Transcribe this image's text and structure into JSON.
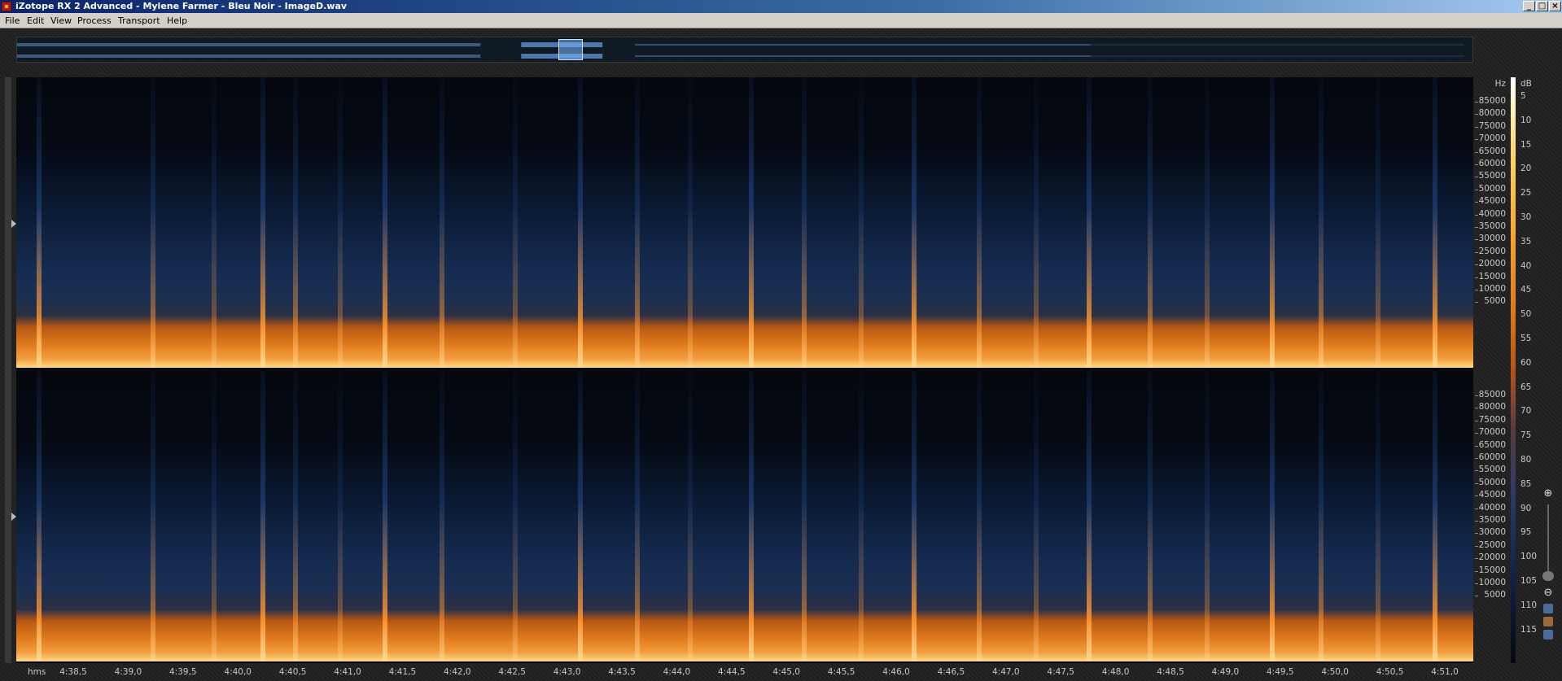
{
  "window": {
    "title": "iZotope RX 2 Advanced - Mylene Farmer - Bleu Noir - ImageD.wav",
    "controls": {
      "minimize": "_",
      "maximize": "□",
      "close": "×"
    }
  },
  "menu": [
    {
      "label": "File"
    },
    {
      "label": "Edit"
    },
    {
      "label": "View"
    },
    {
      "label": "Process"
    },
    {
      "label": "Transport"
    },
    {
      "label": "Help"
    }
  ],
  "spectrogram": {
    "hz_unit": "Hz",
    "hz_labels": [
      "85000",
      "80000",
      "75000",
      "70000",
      "65000",
      "60000",
      "55000",
      "50000",
      "45000",
      "40000",
      "35000",
      "30000",
      "25000",
      "20000",
      "15000",
      "10000",
      "5000"
    ],
    "db_unit": "dB",
    "db_labels": [
      "5",
      "10",
      "15",
      "20",
      "25",
      "30",
      "35",
      "40",
      "45",
      "50",
      "55",
      "60",
      "65",
      "70",
      "75",
      "80",
      "85",
      "90",
      "95",
      "100",
      "105",
      "110",
      "115"
    ],
    "time_unit": "hms",
    "time_labels": [
      "4:38,5",
      "4:39,0",
      "4:39,5",
      "4:40,0",
      "4:40,5",
      "4:41,0",
      "4:41,5",
      "4:42,0",
      "4:42,5",
      "4:43,0",
      "4:43,5",
      "4:44,0",
      "4:44,5",
      "4:45,0",
      "4:45,5",
      "4:46,0",
      "4:46,5",
      "4:47,0",
      "4:47,5",
      "4:48,0",
      "4:48,5",
      "4:49,0",
      "4:49,5",
      "4:50,0",
      "4:50,5",
      "4:51,0"
    ]
  },
  "colors": {
    "title_bar_start": "#0a246a",
    "menu_bg": "#d4d0c8",
    "spectrum_low": "#050810",
    "spectrum_mid": "#2a3a66",
    "spectrum_high": "#f6a030"
  },
  "icons": {
    "app": "izotope-app-icon",
    "zoom_in": "zoom-in-icon",
    "zoom_out": "zoom-out-icon"
  }
}
